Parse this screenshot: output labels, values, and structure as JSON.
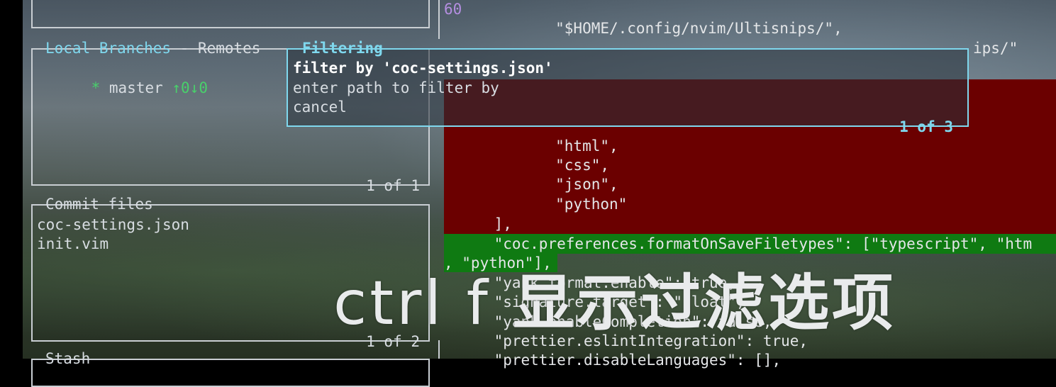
{
  "top_panel": {},
  "branches_panel": {
    "title_local": "Local Branches",
    "title_sep": " - ",
    "title_remotes": "Remotes",
    "branch_marker": "*",
    "branch_name": "master",
    "branch_status": "↑0↓0",
    "counter": "1 of 1"
  },
  "commit_files_panel": {
    "title": "Commit files",
    "files": [
      "coc-settings.json",
      "init.vim"
    ],
    "counter": "1 of 2"
  },
  "stash_panel": {
    "title": "Stash"
  },
  "filter_menu": {
    "title": "Filtering",
    "options": [
      "filter by 'coc-settings.json'",
      "enter path to filter by",
      "cancel"
    ],
    "counter": "1 of 3"
  },
  "diff": {
    "line_number": "60",
    "lines": [
      "        \"$HOME/.config/nvim/Ultisnips/\",",
      "ips/\"",
      "        \"html\",",
      "        \"css\",",
      "        \"json\",",
      "        \"python\"",
      "    ],",
      "    \"coc.preferences.formatOnSaveFiletypes\": [\"typescript\", \"htm",
      ", \"python\"],",
      "    \"yank.format.enable\": true,",
      "    \"signature.target\": \"float\",",
      "    \"yank.enableCompletion\": false,",
      "    \"prettier.eslintIntegration\": true,",
      "    \"prettier.disableLanguages\": [],"
    ]
  },
  "caption": {
    "latin": "ctrl f",
    "chinese": "显示过滤选项"
  },
  "colors": {
    "removed": "#6b0000",
    "added": "#0f7a12",
    "accent": "#7fd8ee",
    "branch": "#49d06b"
  }
}
